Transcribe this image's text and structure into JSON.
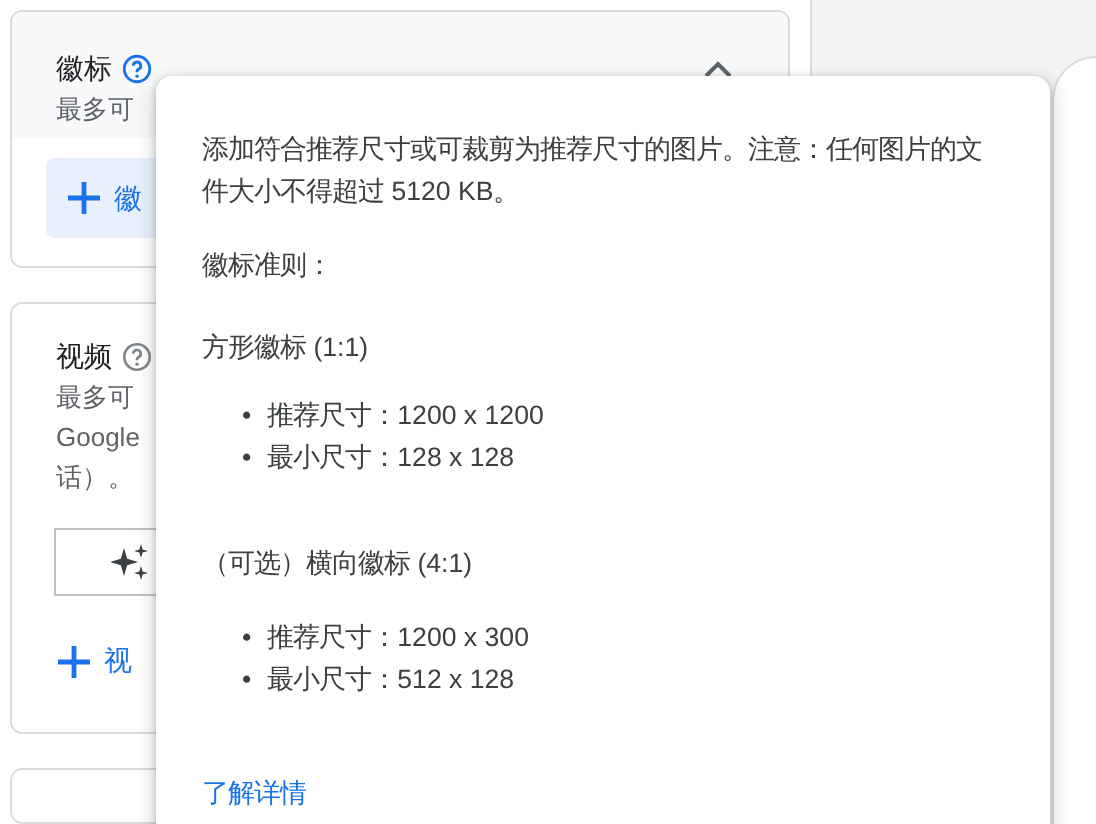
{
  "logo_card": {
    "title": "徽标",
    "description": "最多可",
    "expanded": true,
    "add_button": "徽"
  },
  "video_card": {
    "title": "视频",
    "description_lines": [
      "最多可",
      "Google",
      "话）。"
    ],
    "add_button": "视"
  },
  "tooltip": {
    "intro": "添加符合推荐尺寸或可裁剪为推荐尺寸的图片。注意：任何图片的文件大小不得超过 5120 KB。",
    "guidelines_heading": "徽标准则：",
    "sections": [
      {
        "heading": "方形徽标 (1:1)",
        "items": [
          {
            "marker": "•",
            "text": "推荐尺寸：1200 x 1200"
          },
          {
            "marker": "•",
            "text": "最小尺寸：128 x 128"
          }
        ]
      },
      {
        "heading": "（可选）横向徽标 (4:1)",
        "items": [
          {
            "marker": "•",
            "text": "推荐尺寸：1200 x 300"
          },
          {
            "marker": "•",
            "text": "最小尺寸：512 x 128"
          }
        ]
      }
    ],
    "link": "了解详情"
  }
}
